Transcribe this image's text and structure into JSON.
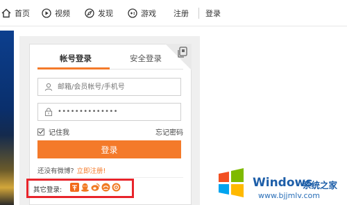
{
  "nav": {
    "home": "首页",
    "video": "视频",
    "discover": "发现",
    "game": "游戏",
    "register": "注册",
    "login": "登录"
  },
  "login": {
    "tab_account": "帐号登录",
    "tab_secure": "安全登录",
    "username_placeholder": "邮箱/会员帐号/手机号",
    "password_masked": "••••••••••••••",
    "remember": "记住我",
    "forgot": "忘记密码",
    "submit": "登录",
    "no_weibo": "还没有微博?",
    "register_now": "立即注册!",
    "other_login": "其它登录:"
  },
  "social_icons": [
    "taobao-icon",
    "qq-icon",
    "weibo-icon",
    "baidu-icon",
    "alipay-icon"
  ],
  "watermark": {
    "title": "Windows",
    "cn": "系统之家",
    "url": "www.bjjmlv.com"
  },
  "colors": {
    "accent": "#f47a2a",
    "highlight": "#e8242b",
    "watermark": "#1d5ea8"
  }
}
